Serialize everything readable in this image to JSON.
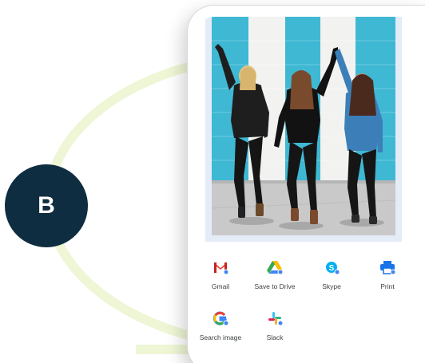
{
  "step_badge": "B",
  "share_sheet": {
    "apps": [
      {
        "label": "Gmail",
        "icon": "gmail-icon"
      },
      {
        "label": "Save to Drive",
        "icon": "google-drive-icon"
      },
      {
        "label": "Skype",
        "icon": "skype-icon"
      },
      {
        "label": "Print",
        "icon": "print-icon"
      },
      {
        "label": "Search image",
        "icon": "google-lens-icon"
      },
      {
        "label": "Slack",
        "icon": "slack-icon"
      }
    ]
  },
  "colors": {
    "badge": "#0f2d40",
    "ring": "#eef6d6",
    "wall_blue": "#3fb8d4",
    "photo_frame": "#e4ecf8"
  }
}
